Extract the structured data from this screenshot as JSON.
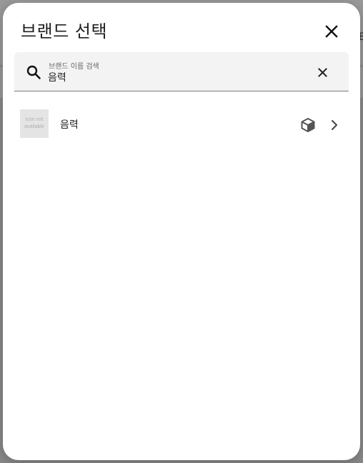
{
  "dialog": {
    "title": "브랜드 선택",
    "close_icon": "close-icon"
  },
  "search": {
    "label": "브랜드 이름 검색",
    "value": "음력",
    "search_icon": "search-icon",
    "clear_icon": "close-icon"
  },
  "results": [
    {
      "thumbnail_text": "icon not available",
      "name": "음력",
      "type_icon": "cube-icon",
      "action_icon": "chevron-right-icon"
    }
  ],
  "backdrop": {
    "edge_text": "E"
  }
}
